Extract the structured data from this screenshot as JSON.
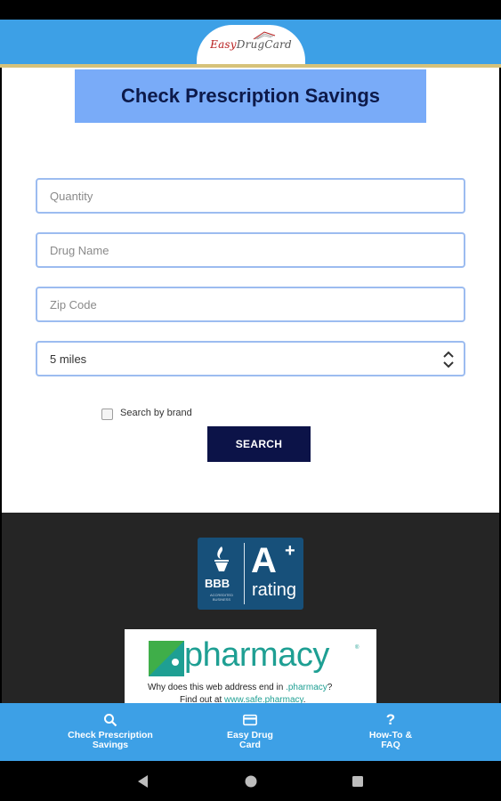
{
  "header": {
    "logo_text_easy": "Easy",
    "logo_text_rest": "DrugCard"
  },
  "main": {
    "title": "Check Prescription Savings",
    "quantity_placeholder": "Quantity",
    "drug_name_placeholder": "Drug Name",
    "zip_placeholder": "Zip Code",
    "distance_value": "5 miles",
    "search_by_brand_label": "Search by brand",
    "search_button_label": "SEARCH"
  },
  "footer": {
    "bbb": {
      "name": "BBB",
      "accredited": "ACCREDITED BUSINESS",
      "grade": "A",
      "grade_plus": "+",
      "rating_word": "rating"
    },
    "pharmacy": {
      "word": "pharmacy",
      "line1_prefix": "Why does this web address end in ",
      "line1_highlight": ".pharmacy",
      "line1_suffix": "?",
      "line2_prefix": "Find out at ",
      "line2_link": "www.safe.pharmacy",
      "line2_suffix": "."
    }
  },
  "bottom_nav": {
    "items": [
      {
        "label": "Check Prescription\nSavings",
        "icon": "search-icon"
      },
      {
        "label": "Easy Drug\nCard",
        "icon": "card-icon"
      },
      {
        "label": "How-To &\nFAQ",
        "icon": "question-icon"
      }
    ]
  },
  "colors": {
    "header_blue": "#3da0e6",
    "title_box": "#79abf8",
    "search_button": "#0c1348",
    "pharmacy_teal": "#1e9f93"
  }
}
